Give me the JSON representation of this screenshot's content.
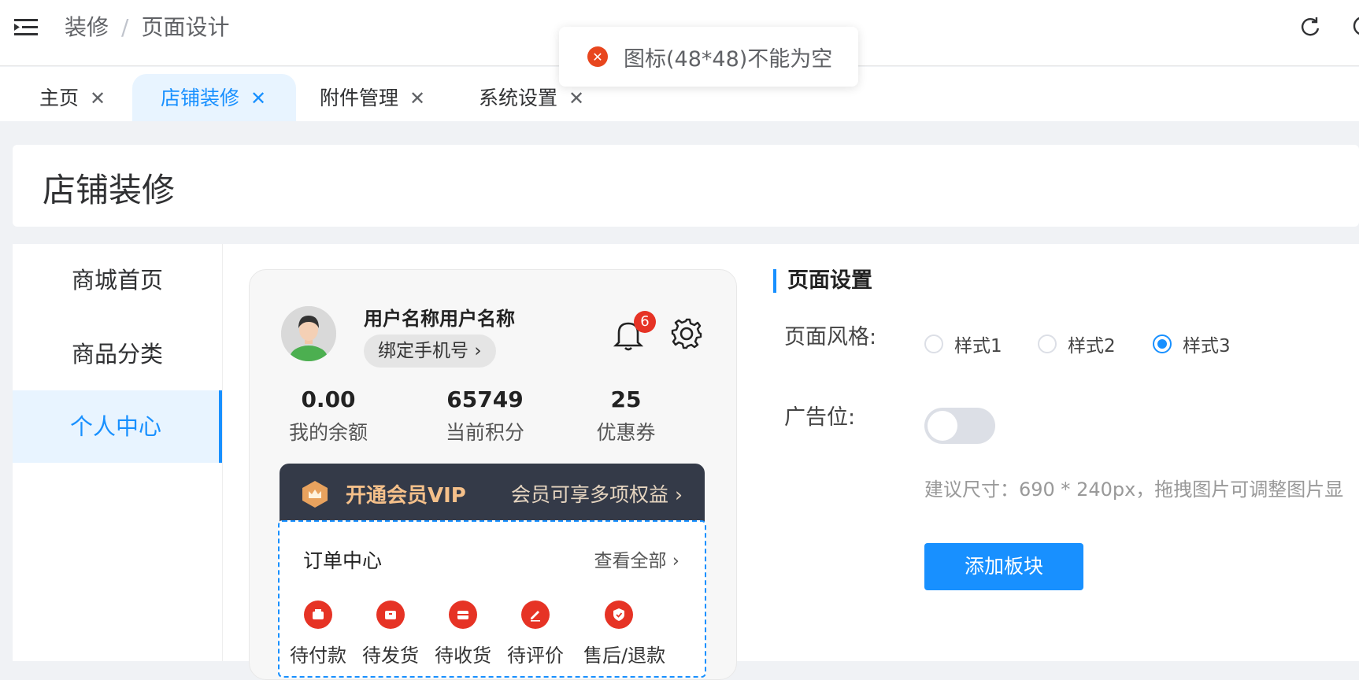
{
  "header": {
    "breadcrumb": [
      "装修",
      "页面设计"
    ],
    "breadcrumb_sep": "/"
  },
  "toast": {
    "message": "图标(48*48)不能为空",
    "icon": "close-circle-icon"
  },
  "tabs": [
    {
      "label": "主页",
      "active": false
    },
    {
      "label": "店铺装修",
      "active": true
    },
    {
      "label": "附件管理",
      "active": false
    },
    {
      "label": "系统设置",
      "active": false
    }
  ],
  "page_title": "店铺装修",
  "left_nav": [
    {
      "label": "商城首页",
      "active": false
    },
    {
      "label": "商品分类",
      "active": false
    },
    {
      "label": "个人中心",
      "active": true
    }
  ],
  "preview": {
    "username": "用户名称用户名称",
    "bind_phone": "绑定手机号",
    "notification_count": "6",
    "stats": [
      {
        "value": "0.00",
        "label": "我的余额"
      },
      {
        "value": "65749",
        "label": "当前积分"
      },
      {
        "value": "25",
        "label": "优惠券"
      }
    ],
    "vip": {
      "title": "开通会员VIP",
      "subtitle": "会员可享多项权益"
    },
    "orders": {
      "title": "订单中心",
      "view_all": "查看全部",
      "items": [
        "待付款",
        "待发货",
        "待收货",
        "待评价",
        "售后/退款"
      ]
    }
  },
  "settings": {
    "title": "页面设置",
    "style_label": "页面风格:",
    "style_options": [
      "样式1",
      "样式2",
      "样式3"
    ],
    "selected_style": "样式3",
    "ad_label": "广告位:",
    "ad_enabled": false,
    "hint": "建议尺寸：690 * 240px，拖拽图片可调整图片显",
    "add_button": "添加板块"
  },
  "colors": {
    "primary": "#1890ff",
    "danger": "#e63325",
    "vip_bg": "#343a48"
  }
}
